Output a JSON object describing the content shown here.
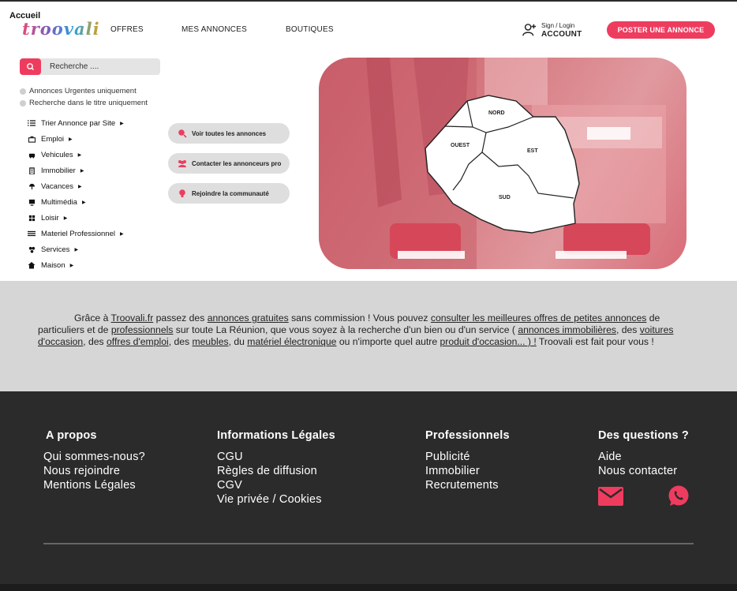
{
  "header": {
    "home_label": "Accueil",
    "logo_text": "troovali",
    "nav": [
      "OFFRES",
      "MES ANNONCES",
      "BOUTIQUES"
    ],
    "account_line1": "Sign / Login",
    "account_line2": "ACCOUNT",
    "post_button": "POSTER UNE ANNONCE"
  },
  "search": {
    "placeholder": "Recherche ....",
    "options": [
      "Annonces Urgentes uniquement",
      "Recherche dans le titre uniquement"
    ]
  },
  "menu": [
    {
      "label": "Trier Annonce par Site",
      "icon": "list-icon"
    },
    {
      "label": "Emploi",
      "icon": "briefcase-icon"
    },
    {
      "label": "Vehicules",
      "icon": "car-icon"
    },
    {
      "label": "Immobilier",
      "icon": "building-icon"
    },
    {
      "label": "Vacances",
      "icon": "umbrella-icon"
    },
    {
      "label": "Multimédia",
      "icon": "monitor-icon"
    },
    {
      "label": "Loisir",
      "icon": "puzzle-icon"
    },
    {
      "label": "Materiel Professionnel",
      "icon": "tools-icon"
    },
    {
      "label": "Services",
      "icon": "services-icon"
    },
    {
      "label": "Maison",
      "icon": "home-icon"
    }
  ],
  "actions": [
    {
      "label": "Voir toutes les annonces",
      "icon": "search-icon"
    },
    {
      "label": "Contacter les annonceurs pro",
      "icon": "users-icon"
    },
    {
      "label": "Rejoindre la communauté",
      "icon": "bulb-icon"
    }
  ],
  "map": {
    "regions": [
      "NORD",
      "OUEST",
      "EST",
      "SUD"
    ]
  },
  "intro": {
    "t1": "Grâce à ",
    "l1": "Troovali.fr",
    "t2": " passez des ",
    "l2": "annonces gratuites",
    "t3": " sans commission ! Vous pouvez ",
    "l3": "consulter les meilleures offres de petites annonces",
    "t4": " de particuliers et de ",
    "l4": "professionnels",
    "t5": " sur toute La Réunion, que vous soyez à la recherche d'un bien ou d'un service ( ",
    "l5": "annonces immobilières",
    "t6": ", des ",
    "l6": "voitures d'occasion",
    "t7": ", des ",
    "l7": "offres d'emploi",
    "t8": ", des ",
    "l8": "meubles",
    "t9": ", du ",
    "l9": "matériel électronique",
    "t10": " ou n'importe quel autre ",
    "l10": "produit d'occasion... ) !",
    "t11": " Troovali est fait pour vous !"
  },
  "footer": {
    "col1": {
      "title": "A propos",
      "links": [
        "Qui sommes-nous?",
        "Nous rejoindre",
        "Mentions Légales"
      ]
    },
    "col2": {
      "title": "Informations Légales",
      "links": [
        "CGU",
        "Règles de diffusion",
        "CGV",
        "Vie privée / Cookies"
      ]
    },
    "col3": {
      "title": "Professionnels",
      "links": [
        "Publicité",
        "Immobilier",
        "Recrutements"
      ]
    },
    "col4": {
      "title": "Des questions ?",
      "links": [
        "Aide",
        "Nous contacter"
      ]
    },
    "contact_icons": [
      "mail-icon",
      "whatsapp-icon"
    ]
  },
  "colors": {
    "accent": "#ee3c5f",
    "footer_bg": "#2b2b2b",
    "band_bg": "#d6d6d6"
  }
}
